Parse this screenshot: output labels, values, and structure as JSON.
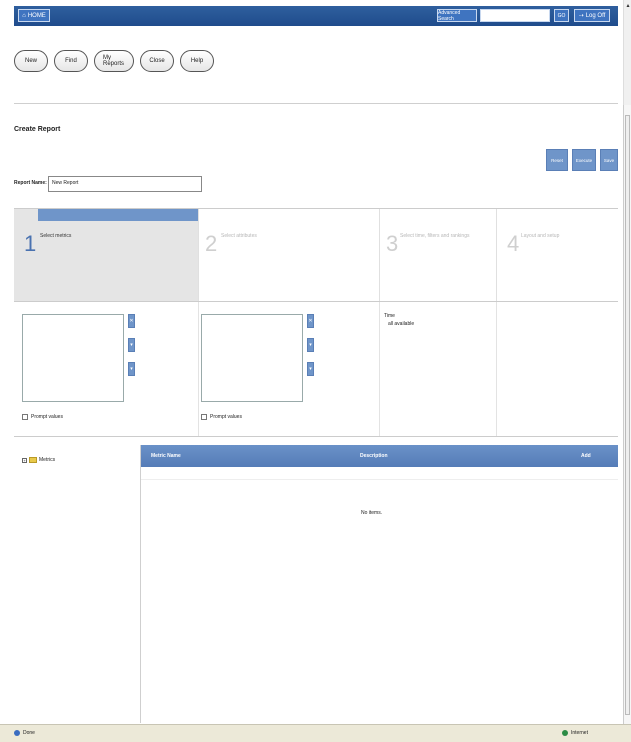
{
  "topbar": {
    "home_label": "HOME",
    "advanced_search_label": "Advanced Search",
    "search_value": "",
    "go_label": "GO",
    "logoff_label": "Log Off"
  },
  "toolbar": {
    "buttons": [
      "New",
      "Find",
      "My Reports",
      "Close",
      "Help"
    ]
  },
  "page": {
    "title": "Create Report",
    "report_name_label": "Report Name:",
    "report_name_value": "New Report",
    "actions": [
      "Reset",
      "Execute",
      "Save"
    ]
  },
  "steps": [
    {
      "num": "1",
      "label": "Select metrics",
      "active": true
    },
    {
      "num": "2",
      "label": "Select attributes",
      "active": false
    },
    {
      "num": "3",
      "label": "Select time, filters and rankings",
      "active": false
    },
    {
      "num": "4",
      "label": "Layout and setup",
      "active": false
    }
  ],
  "config": {
    "prompt_values_label": "Prompt values",
    "time_label": "Time",
    "time_value": "all available"
  },
  "tree": {
    "root_label": "Metrics"
  },
  "grid": {
    "columns": [
      "Metric Name",
      "Description",
      "Add"
    ],
    "empty_message": "No items."
  },
  "statusbar": {
    "left": "Done",
    "right": "Internet"
  }
}
